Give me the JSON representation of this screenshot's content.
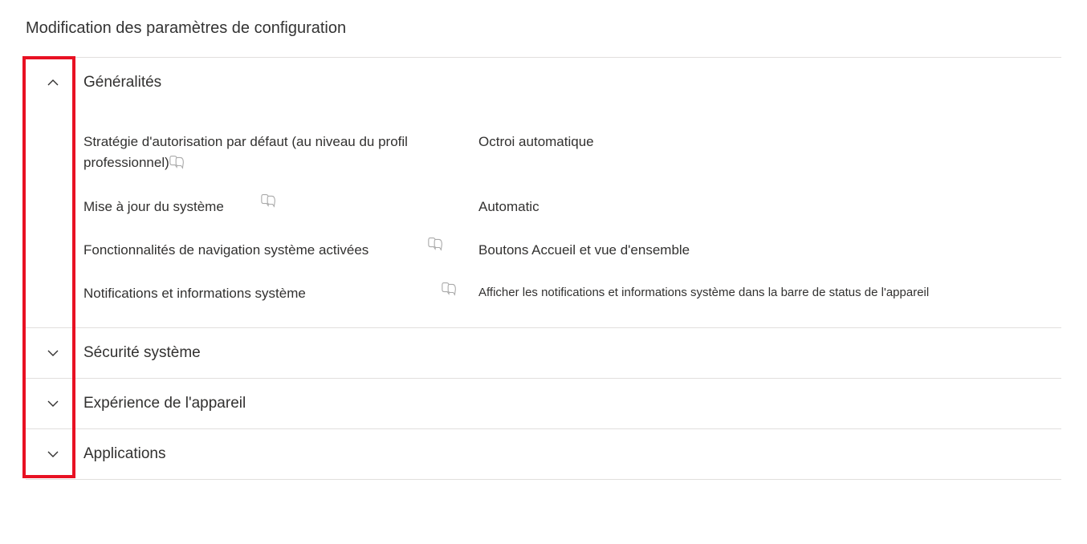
{
  "title": "Modification des paramètres de configuration",
  "sections": {
    "general": {
      "title": "Généralités",
      "rows": {
        "r0": {
          "label": "Stratégie d'autorisation par défaut (au niveau du profil professionnel)",
          "value": "Octroi automatique"
        },
        "r1": {
          "label": "Mise à jour du système",
          "value": "Automatic"
        },
        "r2": {
          "label": "Fonctionnalités de navigation système activées",
          "value": "Boutons Accueil et vue d'ensemble"
        },
        "r3": {
          "label": "Notifications et informations système",
          "value": "Afficher les notifications et informations système dans la barre de status de l'appareil"
        }
      }
    },
    "security": {
      "title": "Sécurité système"
    },
    "experience": {
      "title": "Expérience de l'appareil"
    },
    "applications": {
      "title": "Applications"
    }
  }
}
